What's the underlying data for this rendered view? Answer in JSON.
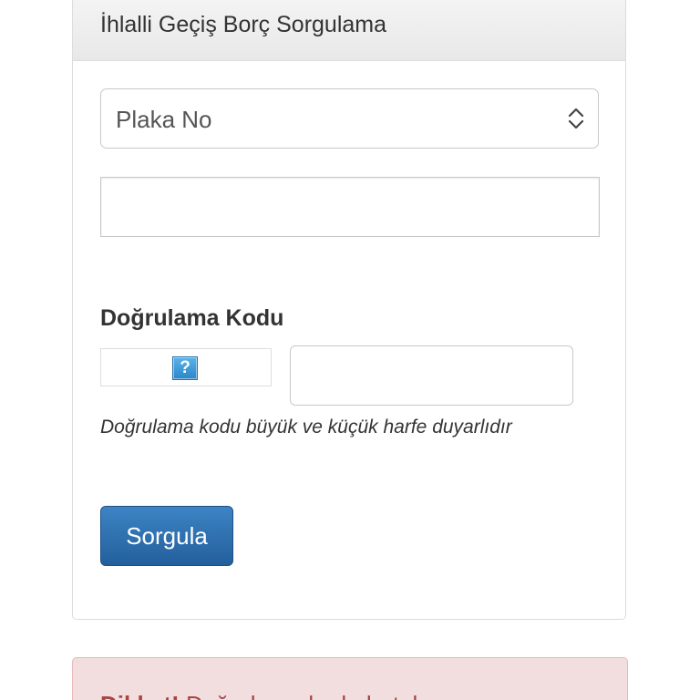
{
  "panel": {
    "title": "İhlalli Geçiş Borç Sorgulama"
  },
  "form": {
    "plate_select": {
      "selected": "Plaka No",
      "icon": "updown-chevron-icon"
    },
    "plate_input": {
      "value": "",
      "placeholder": ""
    },
    "captcha": {
      "label": "Doğrulama Kodu",
      "image_icon": "?",
      "input_value": "",
      "hint": "Doğrulama kodu büyük ve küçük harfe duyarlıdır"
    },
    "submit_label": "Sorgula"
  },
  "alert": {
    "strong": "Dikkat!",
    "message": "Doğrulama kodu hatalı"
  },
  "colors": {
    "button": "#2d6fb0",
    "alert_text": "#a94442",
    "alert_bg": "#f2dede"
  }
}
